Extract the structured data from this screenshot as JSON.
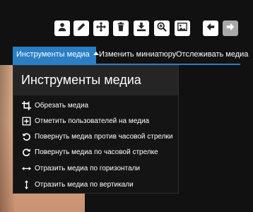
{
  "toolbar": {
    "buttons": [
      {
        "name": "user-icon",
        "enabled": true
      },
      {
        "name": "pencil-icon",
        "enabled": true
      },
      {
        "name": "move-icon",
        "enabled": true
      },
      {
        "name": "trash-icon",
        "enabled": true
      },
      {
        "name": "download-icon",
        "enabled": true
      },
      {
        "name": "zoom-in-icon",
        "enabled": true
      },
      {
        "name": "image-icon",
        "enabled": true
      },
      {
        "name": "arrow-left-icon",
        "enabled": true
      },
      {
        "name": "arrow-right-icon",
        "enabled": false
      }
    ]
  },
  "tabs": [
    {
      "label": "Инструменты медиа",
      "active": true
    },
    {
      "label": "Изменить миниатюру",
      "active": false
    },
    {
      "label": "Отслеживать медиа",
      "active": false
    }
  ],
  "menu": {
    "title": "Инструменты медиа",
    "items": [
      {
        "icon": "crop-icon",
        "label": "Обрезать медиа"
      },
      {
        "icon": "plus-box-icon",
        "label": "Отметить пользователей на медиа"
      },
      {
        "icon": "rotate-ccw-icon",
        "label": "Повернуть медиа против часовой стрелки"
      },
      {
        "icon": "rotate-cw-icon",
        "label": "Повернуть медиа по часовой стрелке"
      },
      {
        "icon": "flip-horizontal-icon",
        "label": "Отразить медиа по горизонтали"
      },
      {
        "icon": "flip-vertical-icon",
        "label": "Отразить медиа по вертикали"
      }
    ]
  },
  "colors": {
    "accent": "#2a7ec4",
    "panel_bg": "#141414",
    "panel_title_bg": "#252525",
    "button_bg": "#ffffff",
    "button_disabled_bg": "#a8a8a8"
  }
}
